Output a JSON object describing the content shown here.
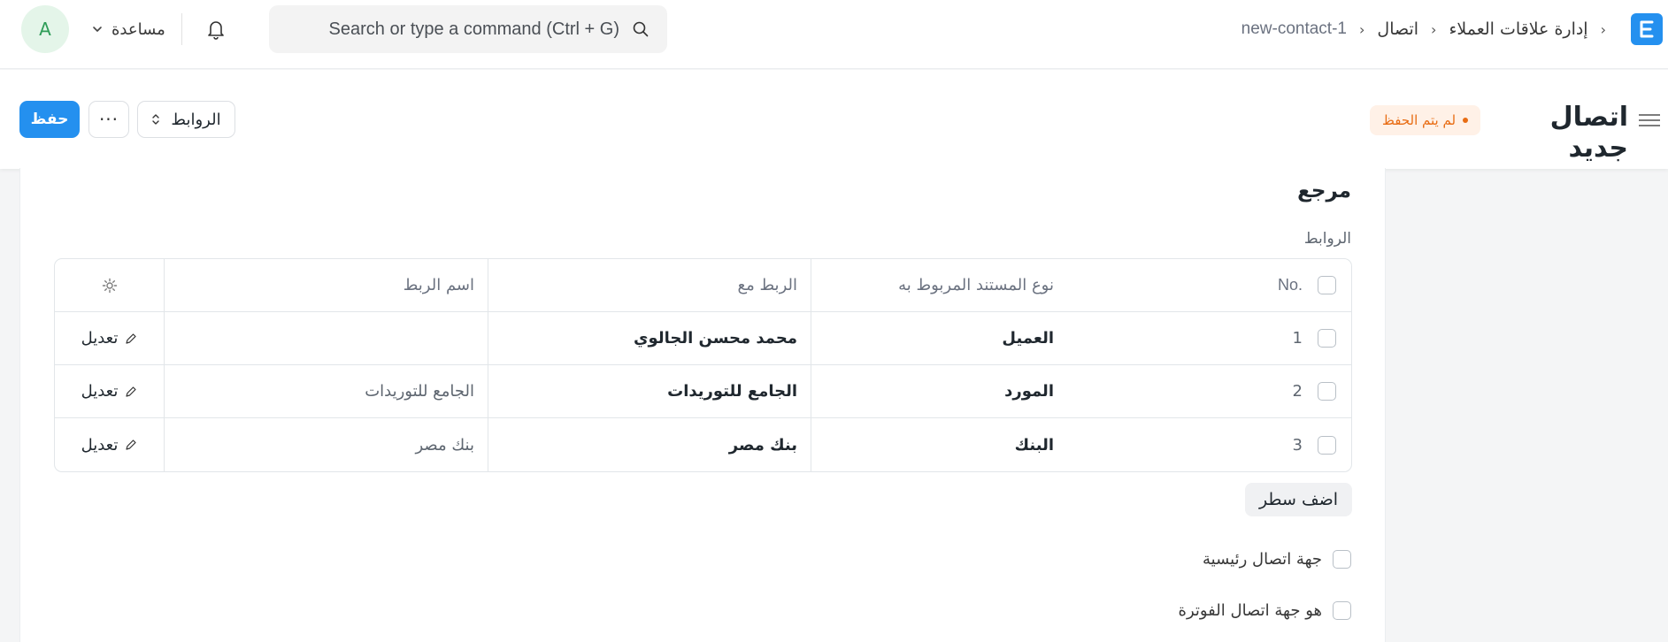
{
  "navbar": {
    "avatar_initial": "A",
    "help_label": "مساعدة",
    "search_placeholder": "Search or type a command (Ctrl + G)",
    "breadcrumbs": [
      "إدارة علاقات العملاء",
      "اتصال",
      "new-contact-1"
    ],
    "app_logo_letter": "E"
  },
  "page_head": {
    "title": "اتصال جديد",
    "status_badge": "لم يتم الحفظ",
    "save_label": "حفظ",
    "more_label": "···",
    "links_label": "الروابط"
  },
  "section": {
    "title": "مرجع",
    "links_field_label": "الروابط",
    "table": {
      "headers": {
        "no": "No.",
        "link_doctype": "نوع المستند المربوط به",
        "link_name": "الربط مع",
        "link_title": "اسم الربط"
      },
      "rows": [
        {
          "no": "1",
          "link_doctype": "العميل",
          "link_name": "محمد محسن الجالوي",
          "link_title": "",
          "edit": "تعديل"
        },
        {
          "no": "2",
          "link_doctype": "المورد",
          "link_name": "الجامع للتوريدات",
          "link_title": "الجامع للتوريدات",
          "edit": "تعديل"
        },
        {
          "no": "3",
          "link_doctype": "البنك",
          "link_name": "بنك مصر",
          "link_title": "بنك مصر",
          "edit": "تعديل"
        }
      ]
    },
    "add_row_label": "اضف سطر",
    "is_primary_contact_label": "جهة اتصال رئيسية",
    "is_billing_contact_label": "هو جهة اتصال الفوترة"
  },
  "colors": {
    "primary": "#2490ef",
    "badge_text": "#e86c13",
    "badge_bg": "#fff1e7",
    "avatar_text": "#2f9d58"
  }
}
